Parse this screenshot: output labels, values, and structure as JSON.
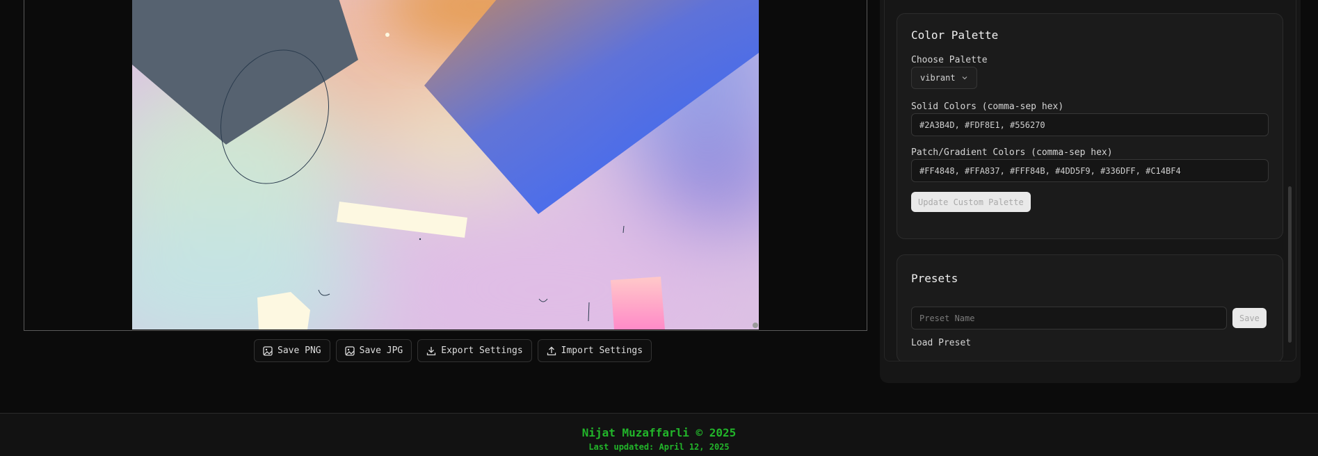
{
  "canvas": {
    "actions": [
      {
        "label": "Save PNG",
        "icon": "image-icon"
      },
      {
        "label": "Save JPG",
        "icon": "image-icon"
      },
      {
        "label": "Export Settings",
        "icon": "download-icon"
      },
      {
        "label": "Import Settings",
        "icon": "upload-icon"
      }
    ]
  },
  "sidebar": {
    "color_palette": {
      "title": "Color Palette",
      "choose_label": "Choose Palette",
      "palette_value": "vibrant",
      "solid_label": "Solid Colors (comma-sep hex)",
      "solid_value": "#2A3B4D, #FDF8E1, #556270",
      "patch_label": "Patch/Gradient Colors (comma-sep hex)",
      "patch_value": "#FF4848, #FFA837, #FFF84B, #4DD5F9, #336DFF, #C14BF4",
      "update_button": "Update Custom Palette"
    },
    "presets": {
      "title": "Presets",
      "name_placeholder": "Preset Name",
      "save_button": "Save",
      "load_label": "Load Preset"
    }
  },
  "footer": {
    "author": "Nijat Muzaffarli © 2025",
    "updated": "Last updated: April 12, 2025"
  },
  "colors": {
    "background": "#0b0b0b",
    "panel": "#161616",
    "card": "#1b1b1b",
    "footer_text": "#22b52a"
  }
}
